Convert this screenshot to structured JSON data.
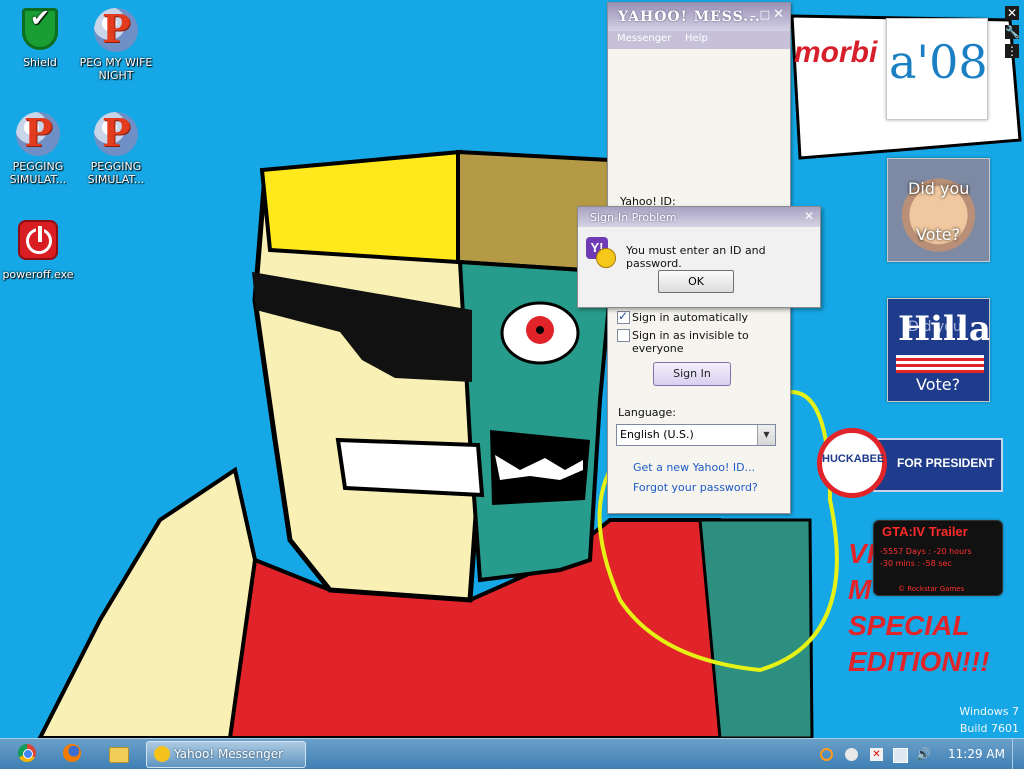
{
  "desktop": {
    "icons": [
      {
        "label": "Shield"
      },
      {
        "label": "PEG MY WIFE\nNIGHT"
      },
      {
        "label": "PEGGING\nSIMULAT..."
      },
      {
        "label": "PEGGING\nSIMULAT..."
      },
      {
        "label": "poweroff.exe"
      }
    ]
  },
  "messenger": {
    "title": "YAHOO! MESS...",
    "menu": [
      "Messenger",
      "Help"
    ],
    "id_label": "Yahoo! ID:",
    "sign_in_auto": "Sign in automatically",
    "sign_in_auto_checked": true,
    "sign_in_invisible": "Sign in as invisible to everyone",
    "sign_in_invisible_checked": false,
    "sign_in_button": "Sign In",
    "language_label": "Language:",
    "language_value": "English (U.S.)",
    "link_new_id": "Get a new Yahoo! ID...",
    "link_forgot": "Forgot your password?"
  },
  "dialog": {
    "title": "Sign-In Problem",
    "message": "You must enter an ID and password.",
    "ok": "OK"
  },
  "gadgets": {
    "banner_text": "morbi",
    "logo_text": "a'08",
    "mccain_top": "Did you",
    "mccain_bottom": "Vote?",
    "hillary_name": "Hilla",
    "hillary_top": "Did you",
    "hillary_bottom": "Vote?",
    "huckabee_name": "HUCKABEE",
    "huckabee_for": "FOR PRESIDENT",
    "gta_title": "GTA:IV Trailer",
    "gta_line1": "-5557 Days : -20 hours",
    "gta_line2": "-30 mins : -58 sec",
    "gta_footer": "© Rockstar Games"
  },
  "wallpaper": {
    "special_text": [
      "VI",
      "M",
      "SPECIAL",
      "EDITION!!!"
    ]
  },
  "watermark": {
    "line1": "Windows 7",
    "line2": "Build 7601"
  },
  "taskbar": {
    "task_label": "Yahoo! Messenger",
    "clock": "11:29 AM"
  },
  "colors": {
    "desktop_bg": "#16a8e6",
    "accent_red": "#e0242a",
    "yahoo_purple": "#6e3bb5"
  }
}
